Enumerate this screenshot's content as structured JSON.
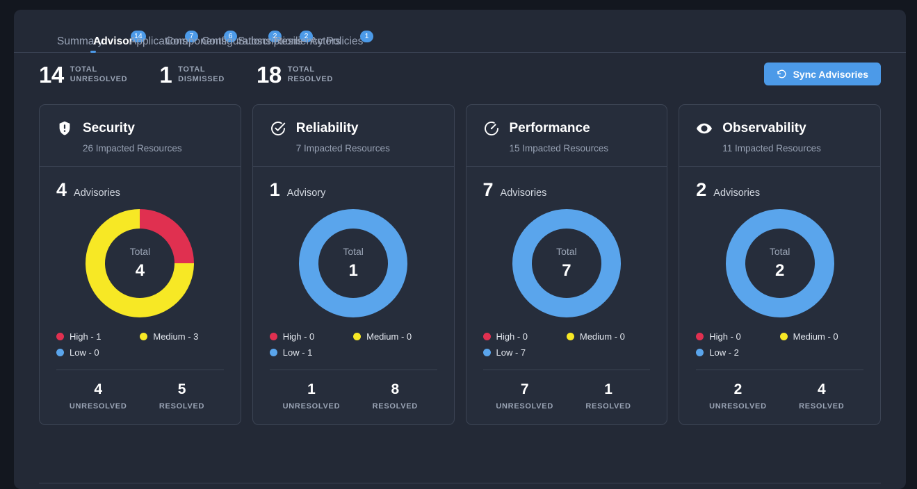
{
  "tabs": [
    {
      "label": "Summary",
      "badge": null,
      "active": false
    },
    {
      "label": "Advisor",
      "badge": "14",
      "active": true
    },
    {
      "label": "Applications",
      "badge": "7",
      "active": false
    },
    {
      "label": "Components",
      "badge": "6",
      "active": false
    },
    {
      "label": "Configurations",
      "badge": "2",
      "active": false
    },
    {
      "label": "Subscriptions",
      "badge": "2",
      "active": false
    },
    {
      "label": "Resiliency Policies",
      "badge": "1",
      "active": false
    },
    {
      "label": "Actors",
      "badge": null,
      "active": false
    }
  ],
  "summary": {
    "stats": [
      {
        "number": "14",
        "line1": "TOTAL",
        "line2": "UNRESOLVED"
      },
      {
        "number": "1",
        "line1": "TOTAL",
        "line2": "DISMISSED"
      },
      {
        "number": "18",
        "line1": "TOTAL",
        "line2": "RESOLVED"
      }
    ],
    "sync_button": "Sync Advisories",
    "sync_icon": "refresh-icon"
  },
  "colors": {
    "accent": "#4c9ae8",
    "high": "#e03050",
    "medium": "#f7e825",
    "low": "#5aa5ec",
    "card_bg": "#262d3b",
    "panel_bg": "#232936",
    "page_bg": "#13171f",
    "border": "#3c4454"
  },
  "center_label": "Total",
  "cards": [
    {
      "icon": "shield-alert-icon",
      "title": "Security",
      "impacted": "26 Impacted Resources",
      "advisories_count": "4",
      "advisories_label": "Advisories",
      "donut_total": "4",
      "legend": [
        {
          "name": "High",
          "value": "1",
          "text": "High - 1",
          "color": "#e03050"
        },
        {
          "name": "Medium",
          "value": "3",
          "text": "Medium - 3",
          "color": "#f7e825"
        },
        {
          "name": "Low",
          "value": "0",
          "text": "Low - 0",
          "color": "#5aa5ec"
        }
      ],
      "footer": [
        {
          "number": "4",
          "label": "UNRESOLVED"
        },
        {
          "number": "5",
          "label": "RESOLVED"
        }
      ]
    },
    {
      "icon": "check-circle-icon",
      "title": "Reliability",
      "impacted": "7 Impacted Resources",
      "advisories_count": "1",
      "advisories_label": "Advisory",
      "donut_total": "1",
      "legend": [
        {
          "name": "High",
          "value": "0",
          "text": "High - 0",
          "color": "#e03050"
        },
        {
          "name": "Medium",
          "value": "0",
          "text": "Medium - 0",
          "color": "#f7e825"
        },
        {
          "name": "Low",
          "value": "1",
          "text": "Low - 1",
          "color": "#5aa5ec"
        }
      ],
      "footer": [
        {
          "number": "1",
          "label": "UNRESOLVED"
        },
        {
          "number": "8",
          "label": "RESOLVED"
        }
      ]
    },
    {
      "icon": "gauge-icon",
      "title": "Performance",
      "impacted": "15 Impacted Resources",
      "advisories_count": "7",
      "advisories_label": "Advisories",
      "donut_total": "7",
      "legend": [
        {
          "name": "High",
          "value": "0",
          "text": "High - 0",
          "color": "#e03050"
        },
        {
          "name": "Medium",
          "value": "0",
          "text": "Medium - 0",
          "color": "#f7e825"
        },
        {
          "name": "Low",
          "value": "7",
          "text": "Low - 7",
          "color": "#5aa5ec"
        }
      ],
      "footer": [
        {
          "number": "7",
          "label": "UNRESOLVED"
        },
        {
          "number": "1",
          "label": "RESOLVED"
        }
      ]
    },
    {
      "icon": "eye-icon",
      "title": "Observability",
      "impacted": "11 Impacted Resources",
      "advisories_count": "2",
      "advisories_label": "Advisories",
      "donut_total": "2",
      "legend": [
        {
          "name": "High",
          "value": "0",
          "text": "High - 0",
          "color": "#e03050"
        },
        {
          "name": "Medium",
          "value": "0",
          "text": "Medium - 0",
          "color": "#f7e825"
        },
        {
          "name": "Low",
          "value": "2",
          "text": "Low - 2",
          "color": "#5aa5ec"
        }
      ],
      "footer": [
        {
          "number": "2",
          "label": "UNRESOLVED"
        },
        {
          "number": "4",
          "label": "RESOLVED"
        }
      ]
    }
  ],
  "chart_data": [
    {
      "type": "pie",
      "title": "Security",
      "labels": [
        "High",
        "Medium",
        "Low"
      ],
      "values": [
        1,
        3,
        0
      ],
      "colors": [
        "#e03050",
        "#f7e825",
        "#5aa5ec"
      ],
      "total": 4,
      "center_label": "Total",
      "legend": "bottom"
    },
    {
      "type": "pie",
      "title": "Reliability",
      "labels": [
        "High",
        "Medium",
        "Low"
      ],
      "values": [
        0,
        0,
        1
      ],
      "colors": [
        "#e03050",
        "#f7e825",
        "#5aa5ec"
      ],
      "total": 1,
      "center_label": "Total",
      "legend": "bottom"
    },
    {
      "type": "pie",
      "title": "Performance",
      "labels": [
        "High",
        "Medium",
        "Low"
      ],
      "values": [
        0,
        0,
        7
      ],
      "colors": [
        "#e03050",
        "#f7e825",
        "#5aa5ec"
      ],
      "total": 7,
      "center_label": "Total",
      "legend": "bottom"
    },
    {
      "type": "pie",
      "title": "Observability",
      "labels": [
        "High",
        "Medium",
        "Low"
      ],
      "values": [
        0,
        0,
        2
      ],
      "colors": [
        "#e03050",
        "#f7e825",
        "#5aa5ec"
      ],
      "total": 2,
      "center_label": "Total",
      "legend": "bottom"
    }
  ]
}
